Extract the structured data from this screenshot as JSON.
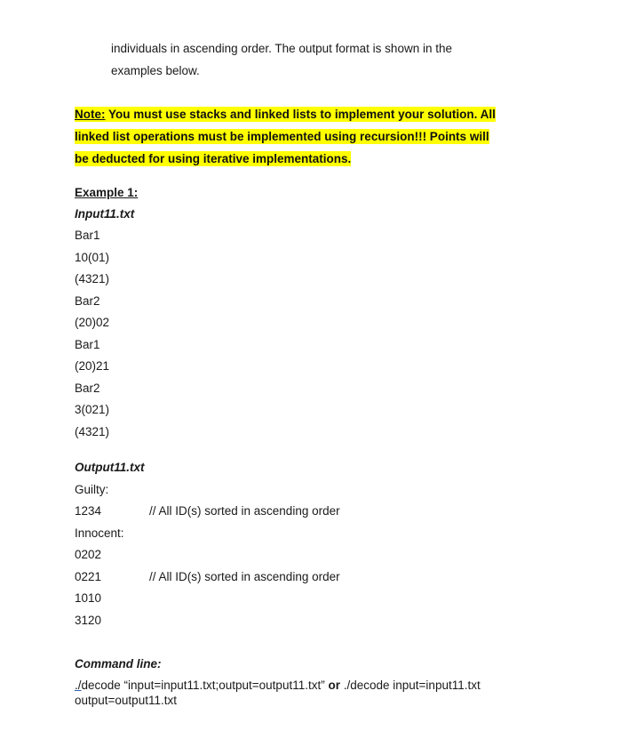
{
  "intro": {
    "line1": "individuals in ascending order. The output format is shown in the",
    "line2": "examples below."
  },
  "note": {
    "label": "Note:",
    "line1_rest": " You must use stacks and linked lists to implement your solution. All",
    "line2": "linked list operations must be implemented using recursion!!!  Points will",
    "line3": "be deducted for using iterative implementations."
  },
  "example": {
    "title": "Example 1:",
    "input_file": "Input11.txt",
    "input_lines": [
      "Bar1",
      "10(01)",
      "(4321)",
      "Bar2",
      "(20)02",
      "Bar1",
      "(20)21",
      "Bar2",
      "3(021)",
      "(4321)"
    ],
    "output_file": "Output11.txt",
    "guilty_label": "Guilty:",
    "guilty_ids": [
      "1234"
    ],
    "guilty_comment": "// All ID(s) sorted in ascending order",
    "innocent_label": "Innocent:",
    "innocent_ids": [
      "0202",
      "0221",
      "1010",
      "3120"
    ],
    "innocent_comment": "// All ID(s) sorted in ascending order"
  },
  "command": {
    "title": "Command line:",
    "part1_link": "./",
    "part1_rest": "decode “input=input11.txt;output=output11.txt”",
    "or": " or ",
    "part2": "./decode input=input11.txt",
    "part3": "output=output11.txt"
  }
}
